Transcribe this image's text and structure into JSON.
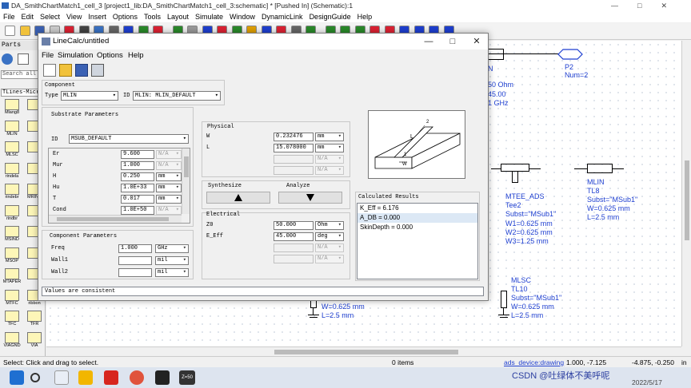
{
  "ads_window": {
    "title": "DA_SmithChartMatch1_cell_3 [project1_lib:DA_SmithChartMatch1_cell_3:schematic] * [Pushed In] (Schematic):1",
    "menu": [
      "File",
      "Edit",
      "Select",
      "View",
      "Insert",
      "Options",
      "Tools",
      "Layout",
      "Simulate",
      "Window",
      "DynamicLink",
      "DesignGuide",
      "Help"
    ]
  },
  "palette": {
    "header": "Parts",
    "search_placeholder": "Search all",
    "library": "TLines-Microstrip",
    "items": [
      "Mlang8",
      "MLIN",
      "MLSC",
      "rindela",
      "rindebr",
      "rindbr",
      "MSIND",
      "MSOP",
      "MTAPER",
      "MTFC",
      "TFC",
      "VIAGND",
      "",
      "",
      "",
      "",
      "MRIND",
      "",
      "",
      "",
      "",
      "ribbon",
      "TFR",
      "VIA"
    ]
  },
  "schematic": {
    "p2": {
      "name": "P2",
      "num": "Num=2"
    },
    "left_partial": {
      "n": "N",
      "z": "50 Ohm",
      "e": "45.00",
      "f": "1 GHz"
    },
    "tee2": {
      "type": "MTEE_ADS",
      "name": "Tee2",
      "subst": "Subst=\"MSub1\"",
      "w1": "W1=0.625 mm",
      "w2": "W2=0.625 mm",
      "w3": "W3=1.25 mm"
    },
    "tl8": {
      "type": "MLIN",
      "name": "TL8",
      "subst": "Subst=\"MSub1\"",
      "w": "W=0.625 mm",
      "l": "L=2.5 mm"
    },
    "tl10": {
      "type": "MLSC",
      "name": "TL10",
      "subst": "Subst=\"MSub1\"",
      "w": "W=0.625 mm",
      "l": "L=2.5 mm"
    },
    "bottom_left": {
      "w": "W=0.625 mm",
      "l": "L=2.5 mm"
    }
  },
  "status": {
    "left": "Select: Click and drag to select.",
    "items": "0 items",
    "mode": "ads_device:drawing",
    "coord1": "1.000, -7.125",
    "coord2": "-4.875, -0.250",
    "unit": "in"
  },
  "taskbar": {
    "date": "2022/5/17",
    "watermark": "CSDN @吐绿体不美呼呢",
    "app_label": "Z=50"
  },
  "dialog": {
    "title": "LineCalc/untitled",
    "menu": [
      "File",
      "Simulation",
      "Options",
      "Help"
    ],
    "component": {
      "label": "Component",
      "type_label": "Type",
      "type_value": "MLIN",
      "id_label": "ID",
      "id_value": "MLIN: MLIN_DEFAULT"
    },
    "substrate": {
      "label": "Substrate Parameters",
      "id_label": "ID",
      "id_value": "MSUB_DEFAULT",
      "rows": [
        {
          "name": "Er",
          "value": "9.600",
          "unit": "N/A",
          "na": true
        },
        {
          "name": "Mur",
          "value": "1.000",
          "unit": "N/A",
          "na": true
        },
        {
          "name": "H",
          "value": "0.250",
          "unit": "mm",
          "na": false
        },
        {
          "name": "Hu",
          "value": "1.0E+33",
          "unit": "mm",
          "na": false
        },
        {
          "name": "T",
          "value": "0.017",
          "unit": "mm",
          "na": false
        },
        {
          "name": "Cond",
          "value": "1.0E+50",
          "unit": "N/A",
          "na": true
        }
      ]
    },
    "component_params": {
      "label": "Component Parameters",
      "rows": [
        {
          "name": "Freq",
          "value": "1.000",
          "unit": "GHz"
        },
        {
          "name": "Wall1",
          "value": "",
          "unit": "mil"
        },
        {
          "name": "Wall2",
          "value": "",
          "unit": "mil"
        }
      ]
    },
    "physical": {
      "label": "Physical",
      "rows": [
        {
          "name": "W",
          "value": "0.232476",
          "unit": "mm",
          "na": false
        },
        {
          "name": "L",
          "value": "15.078000",
          "unit": "mm",
          "na": false
        },
        {
          "name": "",
          "value": "",
          "unit": "N/A",
          "na": true
        },
        {
          "name": "",
          "value": "",
          "unit": "N/A",
          "na": true
        }
      ]
    },
    "synthesize_label": "Synthesize",
    "analyze_label": "Analyze",
    "electrical": {
      "label": "Electrical",
      "rows": [
        {
          "name": "Z0",
          "value": "50.000",
          "unit": "Ohm",
          "na": false
        },
        {
          "name": "E_Eff",
          "value": "45.000",
          "unit": "deg",
          "na": false
        },
        {
          "name": "",
          "value": "",
          "unit": "N/A",
          "na": true
        },
        {
          "name": "",
          "value": "",
          "unit": "N/A",
          "na": true
        }
      ]
    },
    "results": {
      "label": "Calculated Results",
      "lines": [
        "K_Eff = 6.176",
        "A_DB = 0.000",
        "SkinDepth = 0.000"
      ]
    },
    "message": "Values are consistent",
    "diagram_labels": {
      "w": "W",
      "l": "L",
      "p1": "1",
      "p2": "2"
    }
  }
}
